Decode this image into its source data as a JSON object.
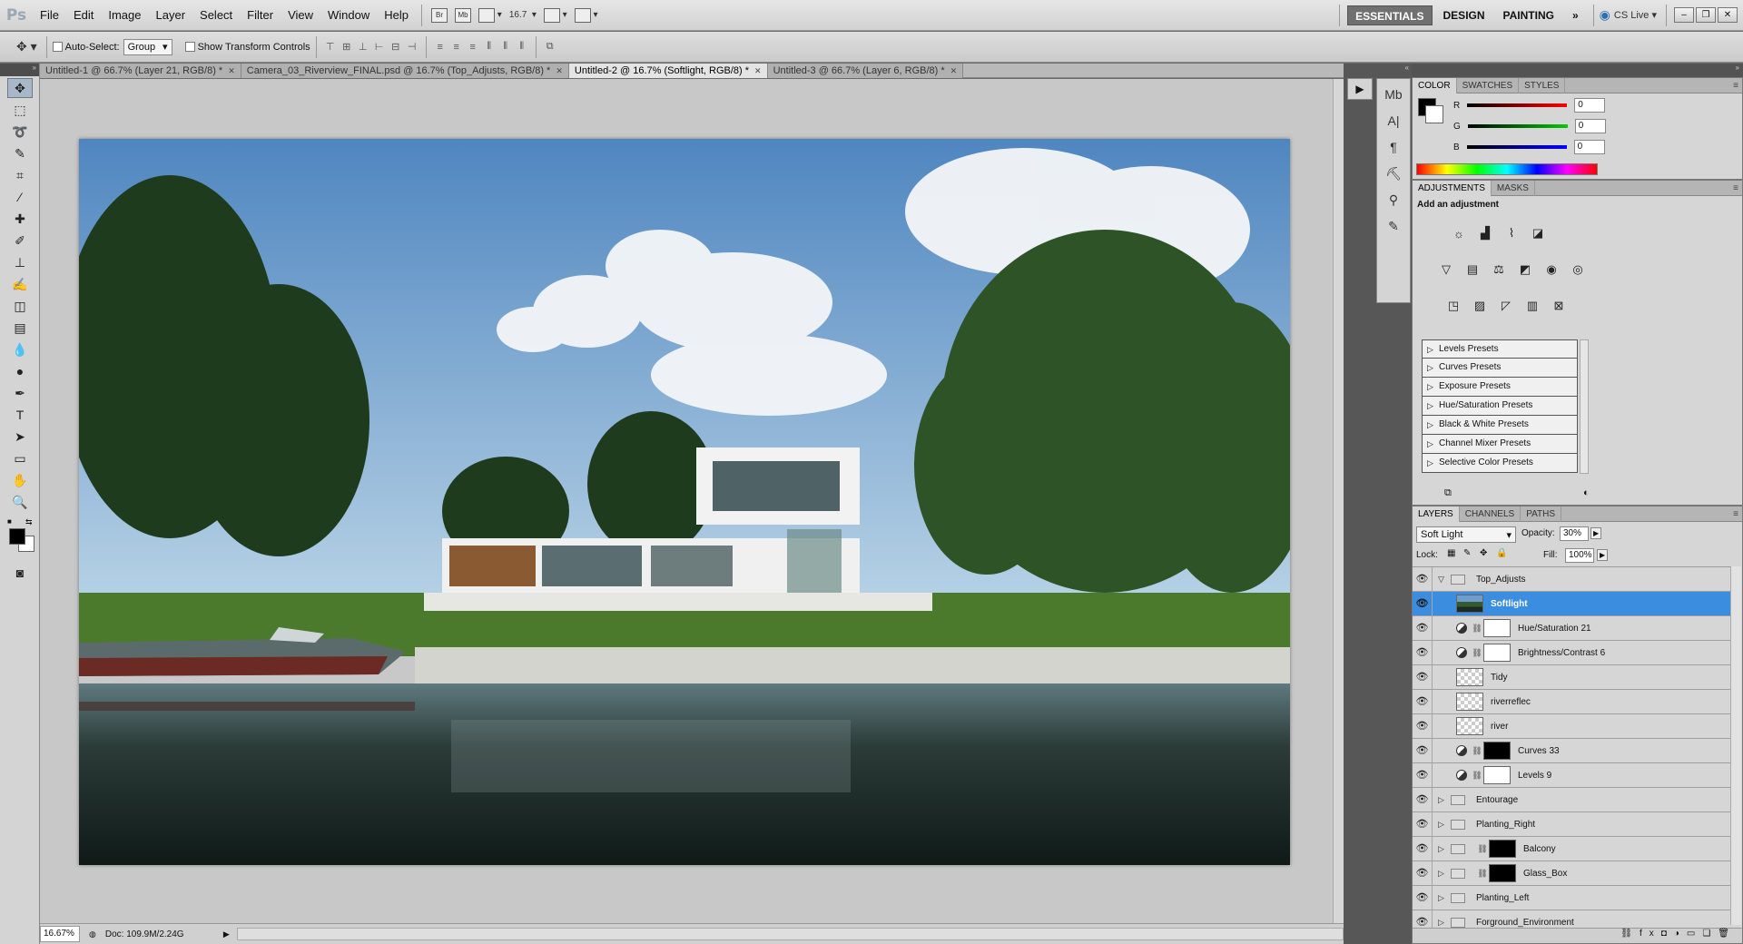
{
  "app_logo": "Ps",
  "menu": [
    "File",
    "Edit",
    "Image",
    "Layer",
    "Select",
    "Filter",
    "View",
    "Window",
    "Help"
  ],
  "appbar": {
    "br": "Br",
    "mb": "Mb",
    "zoom": "16.7"
  },
  "workspaces": {
    "essentials": "ESSENTIALS",
    "design": "DESIGN",
    "painting": "PAINTING",
    "more": "»",
    "cslive": "CS Live"
  },
  "options": {
    "auto_select": "Auto-Select:",
    "auto_select_value": "Group",
    "show_transform": "Show Transform Controls"
  },
  "tabs": [
    "Untitled-1 @ 66.7% (Layer 21, RGB/8) *",
    "Camera_03_Riverview_FINAL.psd @ 16.7% (Top_Adjusts, RGB/8) *",
    "Untitled-2 @ 16.7% (Softlight, RGB/8) *",
    "Untitled-3 @ 66.7% (Layer 6, RGB/8) *"
  ],
  "status": {
    "zoom": "16.67%",
    "doc": "Doc: 109.9M/2.24G"
  },
  "color_panel": {
    "tabs": [
      "COLOR",
      "SWATCHES",
      "STYLES"
    ],
    "r_label": "R",
    "g_label": "G",
    "b_label": "B",
    "r": "0",
    "g": "0",
    "b": "0"
  },
  "adjust_panel": {
    "tabs": [
      "ADJUSTMENTS",
      "MASKS"
    ],
    "heading": "Add an adjustment",
    "presets": [
      "Levels Presets",
      "Curves Presets",
      "Exposure Presets",
      "Hue/Saturation Presets",
      "Black & White Presets",
      "Channel Mixer Presets",
      "Selective Color Presets"
    ]
  },
  "layers_panel": {
    "tabs": [
      "LAYERS",
      "CHANNELS",
      "PATHS"
    ],
    "blend_mode": "Soft Light",
    "opacity_label": "Opacity:",
    "opacity": "30%",
    "lock_label": "Lock:",
    "fill_label": "Fill:",
    "fill": "100%",
    "layers": [
      {
        "name": "Top_Adjusts",
        "type": "group-open"
      },
      {
        "name": "Softlight",
        "type": "image-selected"
      },
      {
        "name": "Hue/Saturation 21",
        "type": "adj-white"
      },
      {
        "name": "Brightness/Contrast 6",
        "type": "adj-white"
      },
      {
        "name": "Tidy",
        "type": "trans"
      },
      {
        "name": "riverreflec",
        "type": "trans"
      },
      {
        "name": "river",
        "type": "trans"
      },
      {
        "name": "Curves 33",
        "type": "adj-black"
      },
      {
        "name": "Levels 9",
        "type": "adj-white"
      },
      {
        "name": "Entourage",
        "type": "group"
      },
      {
        "name": "Planting_Right",
        "type": "group"
      },
      {
        "name": "Balcony",
        "type": "group-mask"
      },
      {
        "name": "Glass_Box",
        "type": "group-mask"
      },
      {
        "name": "Planting_Left",
        "type": "group"
      },
      {
        "name": "Forground_Environment",
        "type": "group"
      }
    ]
  }
}
